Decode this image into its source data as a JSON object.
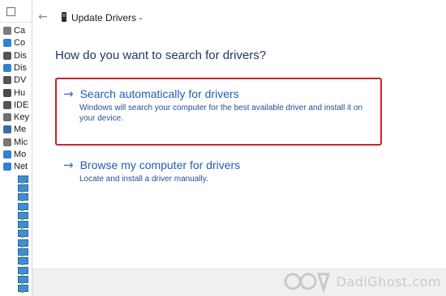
{
  "device_manager": {
    "items": [
      {
        "label": "Ca",
        "icon": "camera-icon",
        "color": "#7a7a7a"
      },
      {
        "label": "Co",
        "icon": "computer-icon",
        "color": "#2f82d3"
      },
      {
        "label": "Dis",
        "icon": "disk-drive-icon",
        "color": "#555555"
      },
      {
        "label": "Dis",
        "icon": "display-adapter-icon",
        "color": "#2f82d3"
      },
      {
        "label": "DV",
        "icon": "dvd-drive-icon",
        "color": "#555555"
      },
      {
        "label": "Hu",
        "icon": "human-interface-icon",
        "color": "#4a4a4a"
      },
      {
        "label": "IDE",
        "icon": "ide-controller-icon",
        "color": "#555555"
      },
      {
        "label": "Key",
        "icon": "keyboard-icon",
        "color": "#6e6e6e"
      },
      {
        "label": "Me",
        "icon": "memory-icon",
        "color": "#3a6ea5"
      },
      {
        "label": "Mic",
        "icon": "mice-icon",
        "color": "#777777"
      },
      {
        "label": "Mo",
        "icon": "monitor-icon",
        "color": "#2f82d3"
      },
      {
        "label": "Net",
        "icon": "network-adapter-icon",
        "color": "#2f82d3"
      }
    ],
    "network_child_count": 13
  },
  "dialog": {
    "back_icon": "←",
    "title": "Update Drivers -",
    "heading": "How do you want to search for drivers?",
    "options": [
      {
        "arrow": "→",
        "title": "Search automatically for drivers",
        "description": "Windows will search your computer for the best available driver and install it on your device.",
        "highlighted": true
      },
      {
        "arrow": "→",
        "title": "Browse my computer for drivers",
        "description": "Locate and install a driver manually.",
        "highlighted": false
      }
    ]
  },
  "watermark": {
    "text": "DadiGhost.com"
  },
  "colors": {
    "highlight_border": "#c9242b",
    "link_blue": "#1f5fb3",
    "heading_blue": "#1f3a66"
  }
}
